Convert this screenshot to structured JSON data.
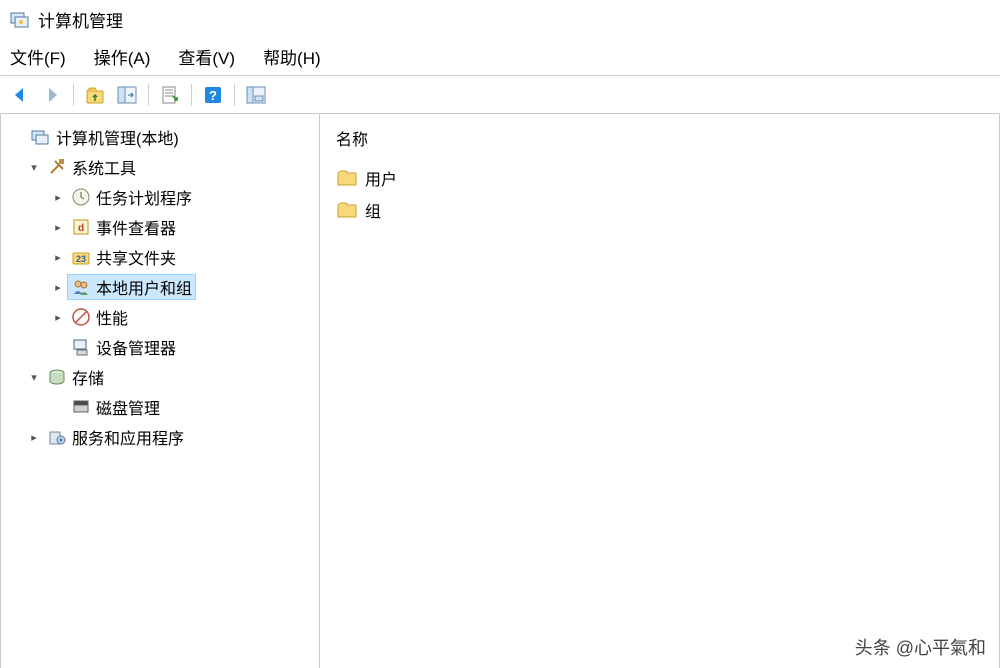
{
  "window": {
    "title": "计算机管理"
  },
  "menu": {
    "file": "文件(F)",
    "action": "操作(A)",
    "view": "查看(V)",
    "help": "帮助(H)"
  },
  "toolbar_icons": {
    "back": "back-icon",
    "forward": "forward-icon",
    "up": "up-icon",
    "show_hide": "show-hide-icon",
    "export": "export-icon",
    "help": "help-icon",
    "tile": "tile-icon"
  },
  "tree": {
    "root": "计算机管理(本地)",
    "system_tools": "系统工具",
    "task_scheduler": "任务计划程序",
    "event_viewer": "事件查看器",
    "shared_folders": "共享文件夹",
    "local_users_groups": "本地用户和组",
    "performance": "性能",
    "device_manager": "设备管理器",
    "storage": "存储",
    "disk_mgmt": "磁盘管理",
    "services_apps": "服务和应用程序"
  },
  "list": {
    "header_name": "名称",
    "users": "用户",
    "groups": "组"
  },
  "watermark": "头条 @心平氣和"
}
